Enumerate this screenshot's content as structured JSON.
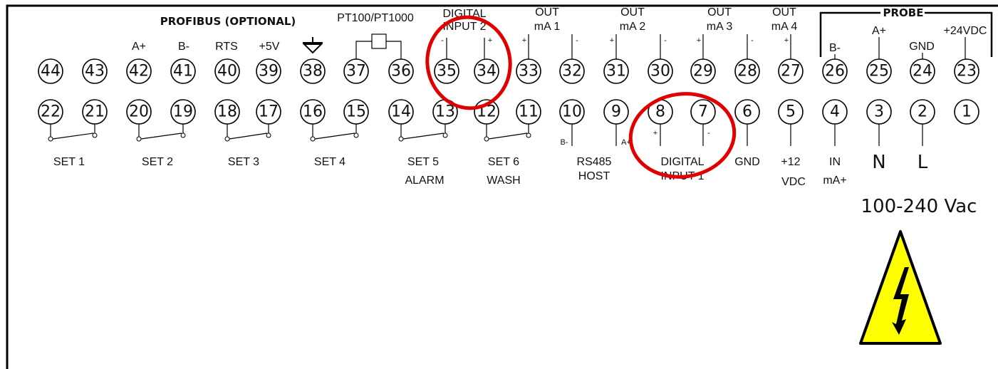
{
  "top_row": [
    "44",
    "43",
    "42",
    "41",
    "40",
    "39",
    "38",
    "37",
    "36",
    "35",
    "34",
    "33",
    "32",
    "31",
    "30",
    "29",
    "28",
    "27",
    "26",
    "25",
    "24",
    "23"
  ],
  "bottom_row": [
    "22",
    "21",
    "20",
    "19",
    "18",
    "17",
    "16",
    "15",
    "14",
    "13",
    "12",
    "11",
    "10",
    "9",
    "8",
    "7",
    "6",
    "5",
    "4",
    "3",
    "2",
    "1"
  ],
  "top_labels": {
    "profibus": "PROFIBUS (OPTIONAL)",
    "a_plus": "A+",
    "b_minus": "B-",
    "rts": "RTS",
    "plus5v": "+5V",
    "pt100": "PT100/PT1000",
    "digital_input2_line1": "DIGITAL",
    "digital_input2_line2": "INPUT 2",
    "out1_line1": "OUT",
    "out1_line2": "mA 1",
    "out2_line1": "OUT",
    "out2_line2": "mA 2",
    "out3_line1": "OUT",
    "out3_line2": "mA 3",
    "out4_line1": "OUT",
    "out4_line2": "mA 4",
    "probe": "PROBE",
    "probe_b_minus": "B-",
    "probe_a_plus": "A+",
    "probe_gnd": "GND",
    "probe_24vdc": "+24VDC",
    "plus": "+",
    "minus": "-"
  },
  "bottom_labels": {
    "set1": "SET 1",
    "set2": "SET 2",
    "set3": "SET 3",
    "set4": "SET 4",
    "set5": "SET 5",
    "alarm": "ALARM",
    "set6": "SET 6",
    "wash": "WASH",
    "rs485": "RS485",
    "host": "HOST",
    "rs_b_minus": "B-",
    "rs_a_plus": "A+",
    "digital_input1_line1": "DIGITAL",
    "digital_input1_line2": "INPUT 1",
    "gnd": "GND",
    "plus12": "+12",
    "vdc": "VDC",
    "in": "IN",
    "ma_plus": "mA+",
    "n": "N",
    "l": "L",
    "plus": "+",
    "minus": "-"
  },
  "voltage": "100-240 Vac",
  "warning_icon": "high-voltage-warning-icon",
  "colors": {
    "highlight": "#e00000",
    "warning_fill": "#ffff00"
  }
}
